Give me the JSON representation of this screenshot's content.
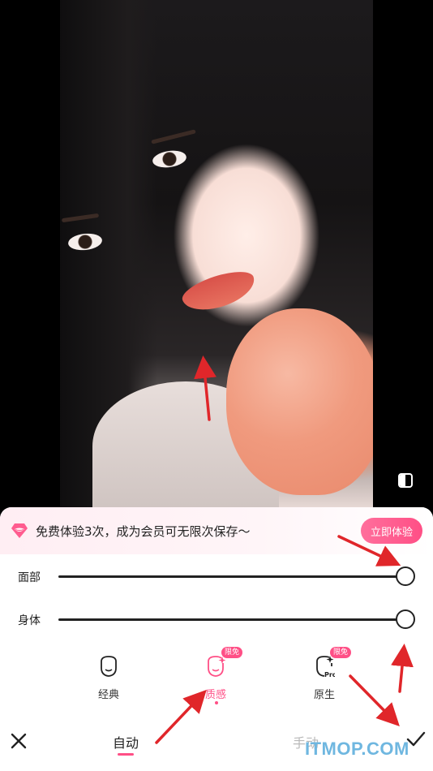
{
  "promo": {
    "text": "免费体验3次，成为会员可无限次保存～",
    "button_label": "立即体验"
  },
  "sliders": [
    {
      "label": "面部",
      "value": 1.0
    },
    {
      "label": "身体",
      "value": 1.0
    }
  ],
  "modes": [
    {
      "label": "经典",
      "badge": "",
      "selected": false
    },
    {
      "label": "质感",
      "badge": "限免",
      "selected": true
    },
    {
      "label": "原生",
      "badge": "限免",
      "icon_text": "Pro",
      "selected": false
    }
  ],
  "tabs": {
    "auto": "自动",
    "manual": "手动",
    "active": "auto"
  },
  "watermark": "ITMOP.COM",
  "colors": {
    "accent": "#ff4f86",
    "annotation_arrow": "#e0262a",
    "watermark": "#6fb7e0"
  },
  "icons": [
    "compare-icon",
    "diamond-lips-icon",
    "close-icon",
    "checkmark-icon"
  ]
}
